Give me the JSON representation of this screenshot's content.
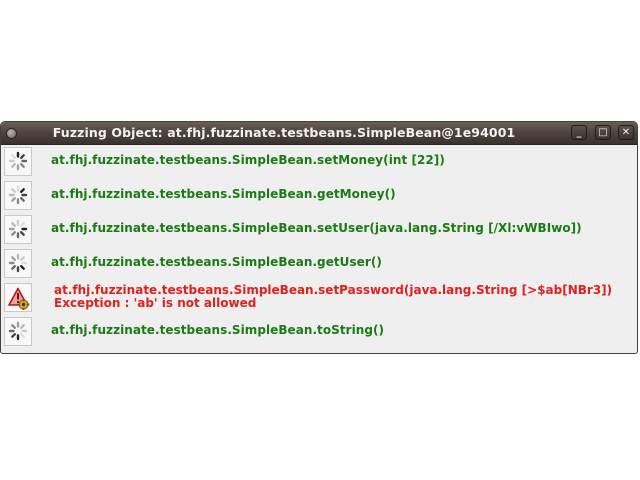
{
  "window": {
    "title": "Fuzzing Object: at.fhj.fuzzinate.testbeans.SimpleBean@1e94001",
    "controls": {
      "minimize": "_",
      "maximize": "□",
      "close": "✕"
    }
  },
  "rows": [
    {
      "status": "running",
      "icon": "loading-spinner-icon",
      "text": "at.fhj.fuzzinate.testbeans.SimpleBean.setMoney(int [22])"
    },
    {
      "status": "running",
      "icon": "loading-spinner-icon",
      "text": "at.fhj.fuzzinate.testbeans.SimpleBean.getMoney()"
    },
    {
      "status": "running",
      "icon": "loading-spinner-icon",
      "text": "at.fhj.fuzzinate.testbeans.SimpleBean.setUser(java.lang.String [/Xl:vWBIwo])"
    },
    {
      "status": "running",
      "icon": "loading-spinner-icon",
      "text": "at.fhj.fuzzinate.testbeans.SimpleBean.getUser()"
    },
    {
      "status": "error",
      "icon": "warning-gear-icon",
      "text": "at.fhj.fuzzinate.testbeans.SimpleBean.setPassword(java.lang.String [>$ab[NBr3])",
      "error": "Exception : 'ab' is not allowed"
    },
    {
      "status": "running",
      "icon": "loading-spinner-icon",
      "text": "at.fhj.fuzzinate.testbeans.SimpleBean.toString()"
    }
  ],
  "colors": {
    "success_text": "#1a7a14",
    "error_text": "#e2201d",
    "titlebar": "#4f453f"
  }
}
